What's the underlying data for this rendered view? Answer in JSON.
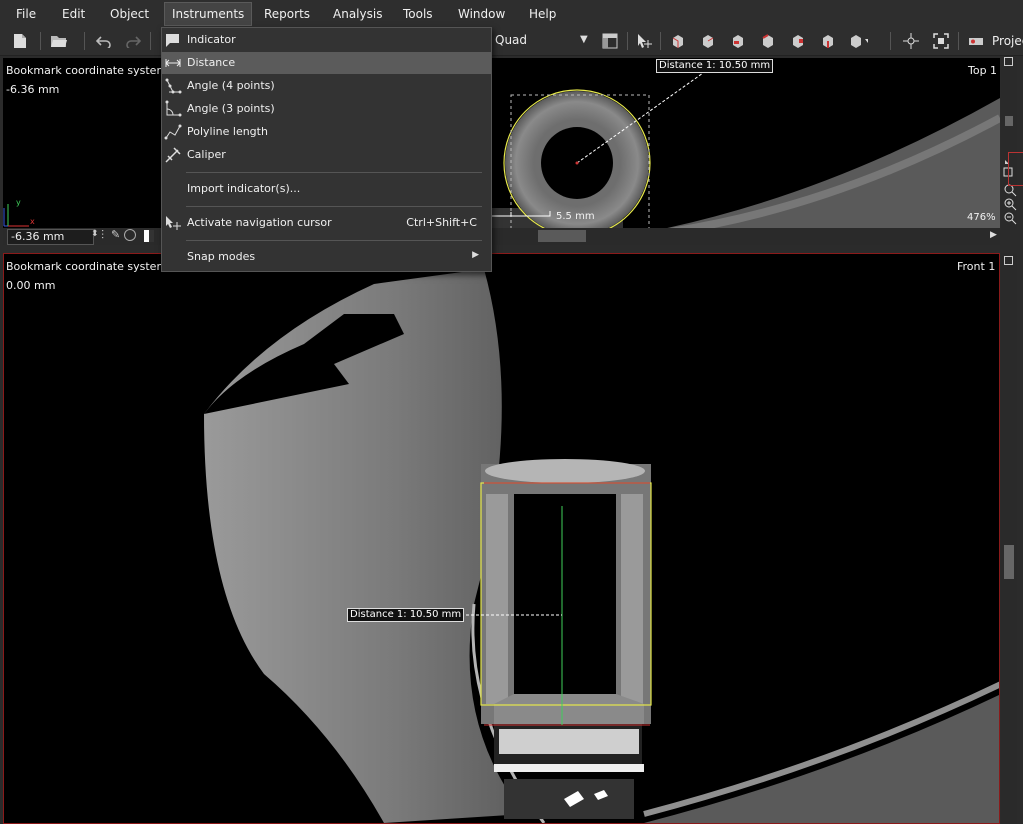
{
  "menubar": {
    "items": [
      "File",
      "Edit",
      "Object",
      "Instruments",
      "Reports",
      "Analysis",
      "Tools",
      "Window",
      "Help"
    ],
    "active": "Instruments"
  },
  "toolbar": {
    "render_mode": "Quad",
    "project_label": "Projec"
  },
  "instruments_menu": {
    "items": [
      {
        "label": "Indicator",
        "icon": "indicator-icon"
      },
      {
        "label": "Distance",
        "icon": "distance-icon",
        "highlighted": true
      },
      {
        "label": "Angle (4 points)",
        "icon": "angle-4-points-icon"
      },
      {
        "label": "Angle (3 points)",
        "icon": "angle-3-points-icon"
      },
      {
        "label": "Polyline length",
        "icon": "polyline-icon"
      },
      {
        "label": "Caliper",
        "icon": "caliper-icon"
      }
    ],
    "import_label": "Import indicator(s)...",
    "nav_cursor": {
      "label": "Activate navigation cursor",
      "shortcut": "Ctrl+Shift+C",
      "icon": "navigation-cursor-icon"
    },
    "snap_modes": "Snap modes"
  },
  "top_view": {
    "coord_system": "Bookmark coordinate system",
    "position": "-6.36 mm",
    "name": "Top 1",
    "distance_label": "Distance 1: 10.50 mm",
    "scale_label": "5.5 mm",
    "zoom": "476%",
    "position_input": "-6.36 mm",
    "axis_x": "x",
    "axis_y": "y"
  },
  "front_view": {
    "coord_system": "Bookmark coordinate system",
    "position": "0.00 mm",
    "name": "Front 1",
    "distance_label": "Distance 1: 10.50 mm"
  },
  "colors": {
    "accent_red": "#8b1a1a",
    "roi_yellow": "#e6e84a",
    "measure_green": "#3fcf5a",
    "menu_highlight": "#5b5b5b"
  }
}
